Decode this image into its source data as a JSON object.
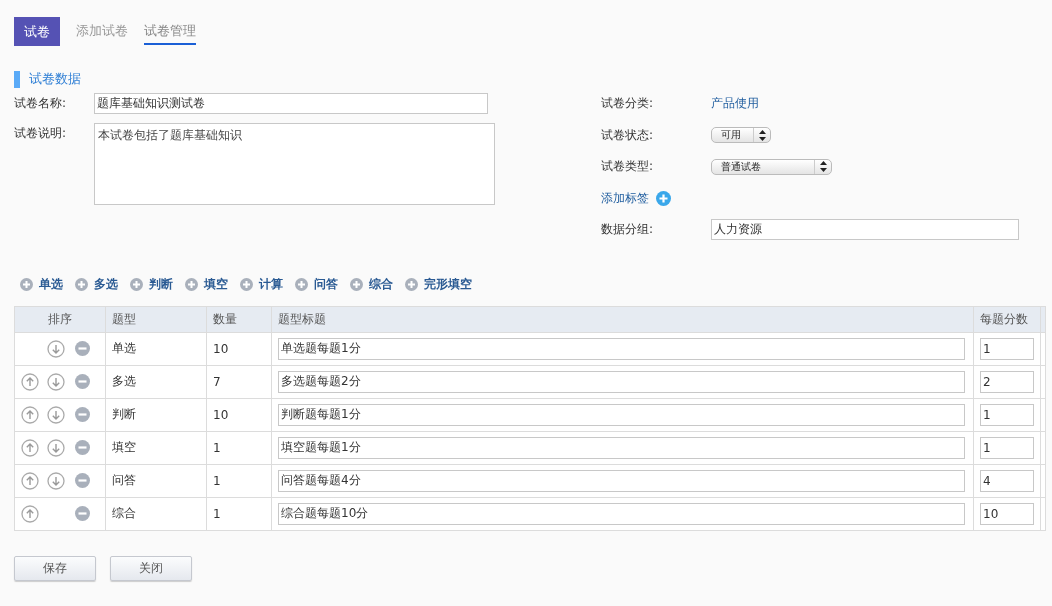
{
  "tabs": [
    {
      "label": "试卷",
      "selected": true
    },
    {
      "label": "添加试卷",
      "selected": false
    },
    {
      "label": "试卷管理",
      "selected": false
    }
  ],
  "section_title": "试卷数据",
  "form_left": {
    "name_label": "试卷名称:",
    "name_value": "题库基础知识测试卷",
    "desc_label": "试卷说明:",
    "desc_value": "本试卷包括了题库基础知识"
  },
  "form_right": {
    "category_label": "试卷分类:",
    "category_value": "产品使用",
    "status_label": "试卷状态:",
    "status_value": "可用",
    "type_label": "试卷类型:",
    "type_value": "普通试卷",
    "add_tag": "添加标签",
    "group_label": "数据分组:",
    "group_value": "人力资源"
  },
  "add_buttons": [
    "单选",
    "多选",
    "判断",
    "填空",
    "计算",
    "问答",
    "综合",
    "完形填空"
  ],
  "table": {
    "columns": [
      "排序",
      "题型",
      "数量",
      "题型标题",
      "每题分数"
    ],
    "rows": [
      {
        "move_up": false,
        "move_down": true,
        "type": "单选",
        "count": "10",
        "title": "单选题每题1分",
        "score": "1"
      },
      {
        "move_up": true,
        "move_down": true,
        "type": "多选",
        "count": "7",
        "title": "多选题每题2分",
        "score": "2"
      },
      {
        "move_up": true,
        "move_down": true,
        "type": "判断",
        "count": "10",
        "title": "判断题每题1分",
        "score": "1"
      },
      {
        "move_up": true,
        "move_down": true,
        "type": "填空",
        "count": "1",
        "title": "填空题每题1分",
        "score": "1"
      },
      {
        "move_up": true,
        "move_down": true,
        "type": "问答",
        "count": "1",
        "title": "问答题每题4分",
        "score": "4"
      },
      {
        "move_up": true,
        "move_down": false,
        "type": "综合",
        "count": "1",
        "title": "综合题每题10分",
        "score": "10"
      }
    ]
  },
  "buttons": [
    "保存",
    "关闭"
  ]
}
